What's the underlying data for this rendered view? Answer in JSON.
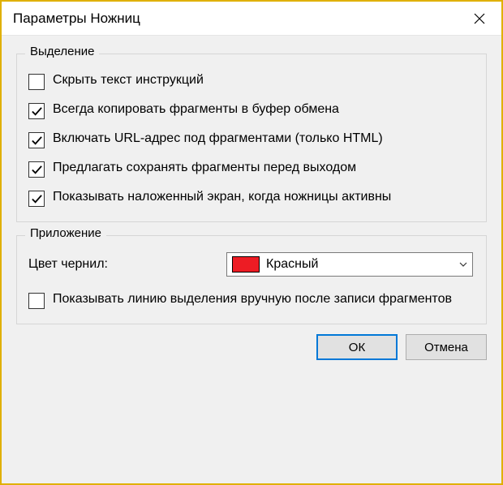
{
  "window": {
    "title": "Параметры Ножниц"
  },
  "groups": {
    "selection": {
      "title": "Выделение",
      "options": {
        "hide_instructions": {
          "label": "Скрыть текст инструкций",
          "checked": false
        },
        "copy_clipboard": {
          "label": "Всегда копировать фрагменты в буфер обмена",
          "checked": true
        },
        "include_url": {
          "label": "Включать URL-адрес под фрагментами (только HTML)",
          "checked": true
        },
        "prompt_save": {
          "label": "Предлагать сохранять фрагменты перед выходом",
          "checked": true
        },
        "show_overlay": {
          "label": "Показывать наложенный экран, когда ножницы активны",
          "checked": true
        }
      }
    },
    "application": {
      "title": "Приложение",
      "ink_color": {
        "label": "Цвет чернил:",
        "value_label": "Красный",
        "value_hex": "#ed1c24"
      },
      "show_selection_line": {
        "label": "Показывать линию выделения вручную после записи фрагментов",
        "checked": false
      }
    }
  },
  "buttons": {
    "ok": "ОК",
    "cancel": "Отмена"
  }
}
